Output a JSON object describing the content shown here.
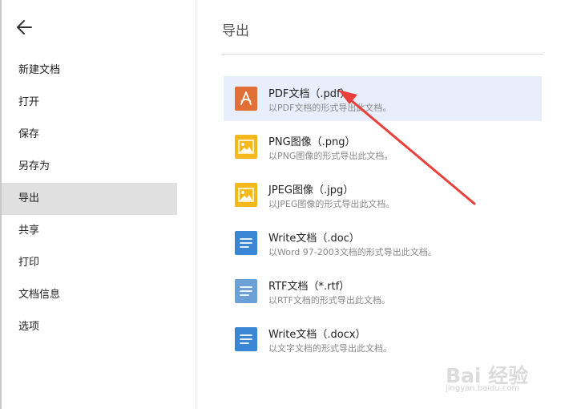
{
  "sidebar": {
    "items": [
      {
        "label": "新建文档"
      },
      {
        "label": "打开"
      },
      {
        "label": "保存"
      },
      {
        "label": "另存为"
      },
      {
        "label": "导出"
      },
      {
        "label": "共享"
      },
      {
        "label": "打印"
      },
      {
        "label": "文档信息"
      },
      {
        "label": "选项"
      }
    ],
    "active_index": 4
  },
  "main": {
    "title": "导出",
    "formats": [
      {
        "title": "PDF文档（.pdf）",
        "desc": "以PDF文档的形式导出此文档。",
        "icon": "pdf-icon",
        "color": "#e07035",
        "selected": true
      },
      {
        "title": "PNG图像（.png）",
        "desc": "以PNG图像的形式导出此文档。",
        "icon": "image-icon",
        "color": "#f6b91d"
      },
      {
        "title": "JPEG图像（.jpg）",
        "desc": "以JPEG图像的形式导出此文档。",
        "icon": "image-icon",
        "color": "#f6b91d"
      },
      {
        "title": "Write文档（.doc）",
        "desc": "以Word 97-2003文档的形式导出此文档。",
        "icon": "document-icon",
        "color": "#3b86d4"
      },
      {
        "title": "RTF文档（*.rtf）",
        "desc": "以RTF文档的形式导出此文档。",
        "icon": "document-icon",
        "color": "#6ea0d8"
      },
      {
        "title": "Write文档（.docx）",
        "desc": "以文字文档的形式导出此文档。",
        "icon": "document-icon",
        "color": "#3b86d4"
      }
    ]
  },
  "watermark": {
    "logo": "Bai 经验",
    "url": "jingyan.baidu.com"
  },
  "colors": {
    "annotation": "#e8403a",
    "selected_bg": "#e8eefb",
    "active_nav_bg": "#e0e0e0"
  }
}
